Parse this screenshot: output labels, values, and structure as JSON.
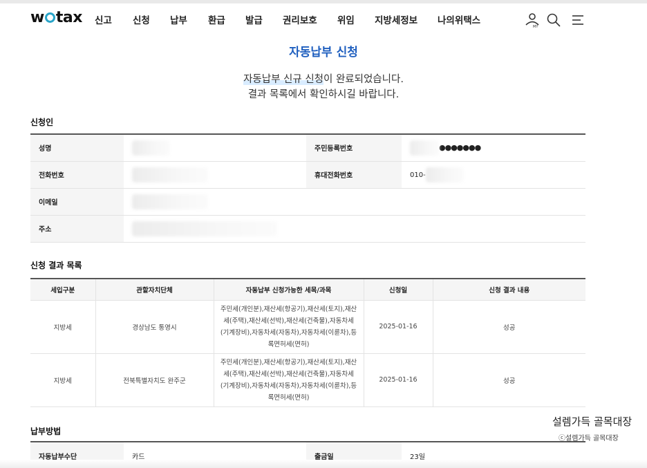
{
  "header": {
    "logo_left": "w",
    "logo_right": "tax",
    "nav": [
      "신고",
      "신청",
      "납부",
      "환급",
      "발급",
      "권리보호",
      "위임",
      "지방세정보",
      "나의위택스"
    ]
  },
  "page": {
    "title": "자동납부 신청",
    "message_highlight": "자동납부 신규 신청",
    "message_rest": "이 완료되었습니다.",
    "message_line2": "결과 목록에서 확인하시길 바랍니다."
  },
  "applicant": {
    "section_title": "신청인",
    "name_label": "성명",
    "rrn_label": "주민등록번호",
    "rrn_masked": "●●●●●●●",
    "phone_label": "전화번호",
    "mobile_label": "휴대전화번호",
    "mobile_prefix": "010-",
    "email_label": "이메일",
    "address_label": "주소"
  },
  "results": {
    "section_title": "신청 결과 목록",
    "columns": [
      "세입구분",
      "관할자치단체",
      "자동납부 신청가능한 세목/과목",
      "신청일",
      "신청 결과 내용"
    ],
    "rows": [
      {
        "category": "지방세",
        "authority": "경상남도 통영시",
        "items": "주민세(개인분),재산세(항공기),재산세(토지),재산세(주택),재산세(선박),재산세(건축물),자동차세(기계장비),자동차세(자동차),자동차세(이륜차),등록면허세(면허)",
        "date": "2025-01-16",
        "result": "성공"
      },
      {
        "category": "지방세",
        "authority": "전북특별자치도 완주군",
        "items": "주민세(개인분),재산세(항공기),재산세(토지),재산세(주택),재산세(선박),재산세(건축물),자동차세(기계장비),자동차세(자동차),자동차세(이륜차),등록면허세(면허)",
        "date": "2025-01-16",
        "result": "성공"
      }
    ]
  },
  "payment": {
    "section_title": "납부방법",
    "method_label": "자동납부수단",
    "method_value": "카드",
    "withdraw_label": "출금일",
    "withdraw_value": "23일"
  },
  "watermark": {
    "title": "설렘가득 골목대장",
    "credit": "ⓒ설렘가득 골목대장"
  },
  "colors": {
    "accent": "#1f5fbf",
    "logo_ring": "#2aa5c9"
  }
}
